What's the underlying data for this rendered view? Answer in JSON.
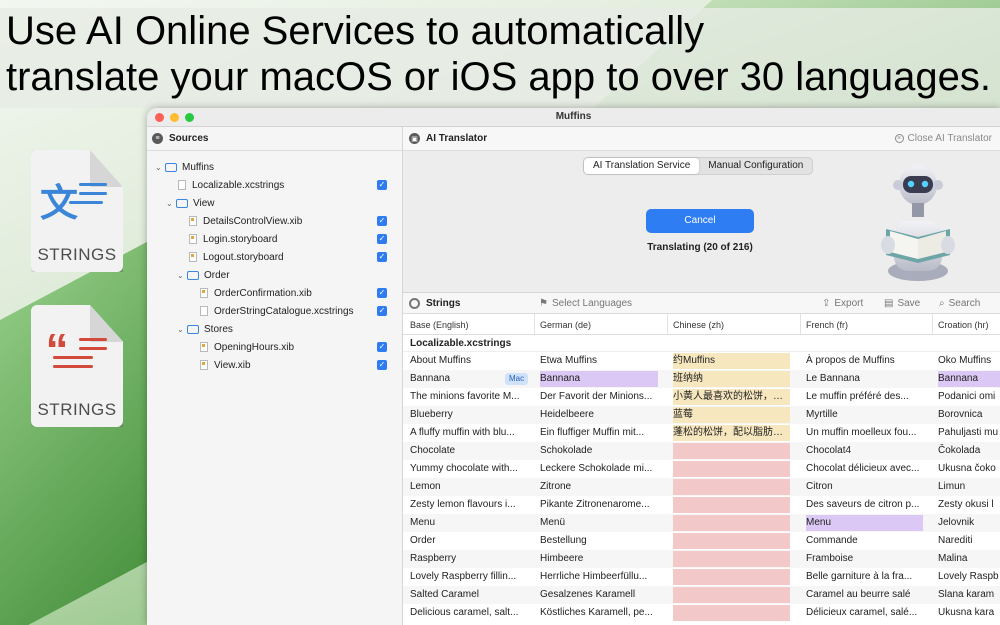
{
  "headline": {
    "line1": "Use AI Online Services to automatically",
    "line2": "translate your macOS or iOS app to over 30 languages."
  },
  "file_icons": [
    {
      "glyph": "文",
      "label": "STRINGS",
      "color": "#3b86d8"
    },
    {
      "glyph": "“",
      "label": "STRINGS",
      "color": "#d24a3c"
    }
  ],
  "window": {
    "title": "Muffins"
  },
  "sidebar": {
    "title": "Sources",
    "items": [
      {
        "label": "Muffins",
        "kind": "folder",
        "depth": 0,
        "expanded": true
      },
      {
        "label": "Localizable.xcstrings",
        "kind": "file",
        "depth": 1,
        "checked": true
      },
      {
        "label": "View",
        "kind": "folder",
        "depth": 1,
        "expanded": true
      },
      {
        "label": "DetailsControlView.xib",
        "kind": "xib",
        "depth": 2,
        "checked": true
      },
      {
        "label": "Login.storyboard",
        "kind": "xib",
        "depth": 2,
        "checked": true
      },
      {
        "label": "Logout.storyboard",
        "kind": "xib",
        "depth": 2,
        "checked": true
      },
      {
        "label": "Order",
        "kind": "folder",
        "depth": 2,
        "expanded": true
      },
      {
        "label": "OrderConfirmation.xib",
        "kind": "xib",
        "depth": 3,
        "checked": true
      },
      {
        "label": "OrderStringCatalogue.xcstrings",
        "kind": "file",
        "depth": 3,
        "checked": true
      },
      {
        "label": "Stores",
        "kind": "folder",
        "depth": 2,
        "expanded": true
      },
      {
        "label": "OpeningHours.xib",
        "kind": "xib",
        "depth": 3,
        "checked": true
      },
      {
        "label": "View.xib",
        "kind": "xib",
        "depth": 3,
        "checked": true
      }
    ]
  },
  "ai_translator": {
    "title": "AI Translator",
    "close_label": "Close AI Translator",
    "tabs": [
      "AI Translation Service",
      "Manual Configuration"
    ],
    "active_tab": 0,
    "cancel_label": "Cancel",
    "status": "Translating (20 of 216)"
  },
  "strings_toolbar": {
    "title": "Strings",
    "select_languages": "Select Languages",
    "export": "Export",
    "save": "Save",
    "search": "Search"
  },
  "table": {
    "columns": [
      "Base (English)",
      "German (de)",
      "Chinese (zh)",
      "French (fr)",
      "Croation (hr)"
    ],
    "group": "Localizable.xcstrings",
    "badge": "Mac",
    "highlight_colors": {
      "pending": "#f7e7bf",
      "missing": "#f2c8c9",
      "selected": "#dcc8f4"
    },
    "rows": [
      {
        "cells": [
          "About Muffins",
          "Etwa Muffins",
          "约Muffins",
          "À propos de Muffins",
          "Oko Muffins"
        ],
        "hl": [
          "",
          "",
          "pending",
          "",
          ""
        ]
      },
      {
        "cells": [
          "Bannana",
          "Bannana",
          "班纳纳",
          "Le Bannana",
          "Bannana"
        ],
        "hl": [
          "",
          "selected",
          "pending",
          "",
          "selected"
        ],
        "badge": true
      },
      {
        "cells": [
          "The minions favorite M...",
          "Der Favorit der Minions...",
          "小黄人最喜欢的松饼，香…",
          "Le muffin préféré des...",
          "Podanici omi"
        ],
        "hl": [
          "",
          "",
          "pending",
          "",
          ""
        ]
      },
      {
        "cells": [
          "Blueberry",
          "Heidelbeere",
          "蓝莓",
          "Myrtille",
          "Borovnica"
        ],
        "hl": [
          "",
          "",
          "pending",
          "",
          ""
        ]
      },
      {
        "cells": [
          "A fluffy muffin with blu...",
          "Ein fluffiger Muffin mit...",
          "蓬松的松饼，配以脂肪和…",
          "Un muffin moelleux fou...",
          "Pahuljasti mu"
        ],
        "hl": [
          "",
          "",
          "pending",
          "",
          ""
        ]
      },
      {
        "cells": [
          "Chocolate",
          "Schokolade",
          "",
          "Chocolat4",
          "Čokolada"
        ],
        "hl": [
          "",
          "",
          "missing",
          "",
          ""
        ]
      },
      {
        "cells": [
          "Yummy chocolate with...",
          "Leckere Schokolade mi...",
          "",
          "Chocolat délicieux avec...",
          "Ukusna čoko"
        ],
        "hl": [
          "",
          "",
          "missing",
          "",
          ""
        ]
      },
      {
        "cells": [
          "Lemon",
          "Zitrone",
          "",
          "Citron",
          "Limun"
        ],
        "hl": [
          "",
          "",
          "missing",
          "",
          ""
        ]
      },
      {
        "cells": [
          "Zesty lemon flavours i...",
          "Pikante Zitronenarome...",
          "",
          "Des saveurs de citron p...",
          "Zesty okusi l"
        ],
        "hl": [
          "",
          "",
          "missing",
          "",
          ""
        ]
      },
      {
        "cells": [
          "Menu",
          "Menü",
          "",
          "Menu",
          "Jelovnik"
        ],
        "hl": [
          "",
          "",
          "missing",
          "selected",
          ""
        ]
      },
      {
        "cells": [
          "Order",
          "Bestellung",
          "",
          "Commande",
          "Narediti"
        ],
        "hl": [
          "",
          "",
          "missing",
          "",
          ""
        ]
      },
      {
        "cells": [
          "Raspberry",
          "Himbeere",
          "",
          "Framboise",
          "Malina"
        ],
        "hl": [
          "",
          "",
          "missing",
          "",
          ""
        ]
      },
      {
        "cells": [
          "Lovely Raspberry fillin...",
          "Herrliche Himbeerfüllu...",
          "",
          "Belle garniture à la fra...",
          "Lovely Raspb"
        ],
        "hl": [
          "",
          "",
          "missing",
          "",
          ""
        ]
      },
      {
        "cells": [
          "Salted Caramel",
          "Gesalzenes Karamell",
          "",
          "Caramel au beurre salé",
          "Slana karam"
        ],
        "hl": [
          "",
          "",
          "missing",
          "",
          ""
        ]
      },
      {
        "cells": [
          "Delicious caramel, salt...",
          "Köstliches Karamell, pe...",
          "",
          "Délicieux caramel, salé...",
          "Ukusna kara"
        ],
        "hl": [
          "",
          "",
          "missing",
          "",
          ""
        ]
      }
    ]
  }
}
